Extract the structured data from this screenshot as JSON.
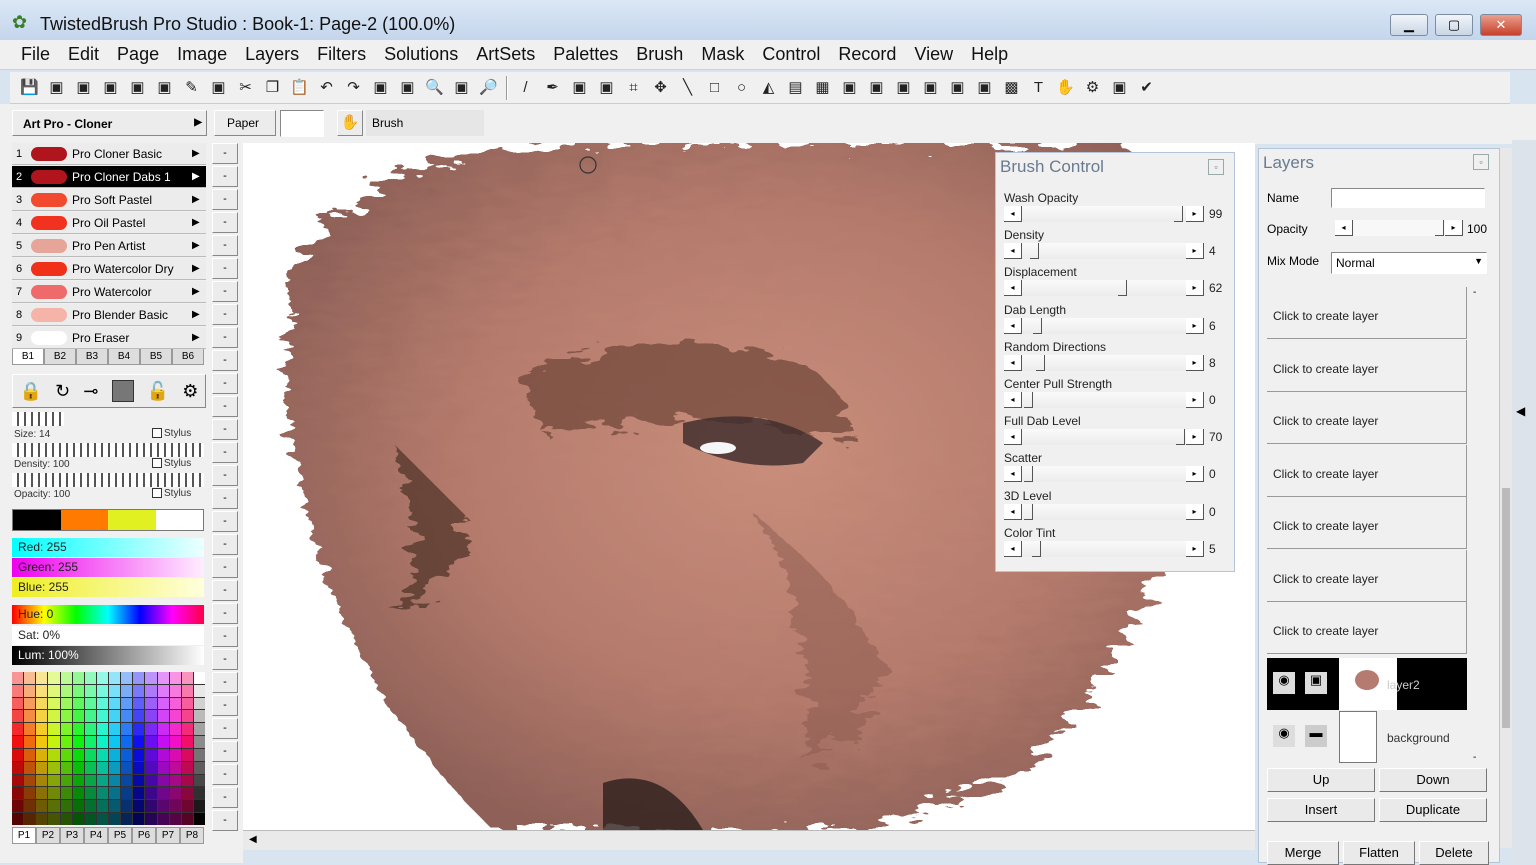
{
  "window": {
    "title": "TwistedBrush Pro Studio : Book-1: Page-2 (100.0%)",
    "minimize": "▁",
    "maximize": "▢",
    "close": "✕"
  },
  "menu": [
    "File",
    "Edit",
    "Page",
    "Image",
    "Layers",
    "Filters",
    "Solutions",
    "ArtSets",
    "Palettes",
    "Brush",
    "Mask",
    "Control",
    "Record",
    "View",
    "Help"
  ],
  "toolbar": {
    "icons": [
      "save-icon",
      "save-as-icon",
      "page-icon",
      "new-page-icon",
      "page-settings-icon",
      "pages-icon",
      "pencil-icon",
      "print-icon",
      "cut-icon",
      "copy-icon",
      "paste-icon",
      "undo-icon",
      "redo-icon",
      "repeat-icon",
      "clear-icon",
      "zoom-in-icon",
      "fit-icon",
      "zoom-out-icon",
      "|",
      "line-brush-icon",
      "eyedropper-icon",
      "select-icon",
      "rect-select-icon",
      "crop-icon",
      "move-icon",
      "line-icon",
      "rect-icon",
      "ellipse-icon",
      "fill-icon",
      "gradient-icon",
      "pattern-icon",
      "shape-icon",
      "tree-icon",
      "lasso-icon",
      "spray-icon",
      "stamp-icon",
      "clone-icon",
      "grid-icon",
      "text-icon",
      "hand-icon",
      "settings-icon",
      "tool-icon",
      "check-icon"
    ]
  },
  "artset": {
    "name": "Art Pro - Cloner"
  },
  "paper_label": "Paper",
  "brush_label": "Brush",
  "brushes": [
    {
      "num": "1",
      "name": "Pro Cloner Basic",
      "color": "#b0141c"
    },
    {
      "num": "2",
      "name": "Pro Cloner Dabs 1",
      "color": "#b0141c"
    },
    {
      "num": "3",
      "name": "Pro Soft Pastel",
      "color": "#f24a2e"
    },
    {
      "num": "4",
      "name": "Pro Oil Pastel",
      "color": "#f0321e"
    },
    {
      "num": "5",
      "name": "Pro Pen Artist",
      "color": "#e7a59a"
    },
    {
      "num": "6",
      "name": "Pro Watercolor Dry",
      "color": "#f03018"
    },
    {
      "num": "7",
      "name": "Pro Watercolor",
      "color": "#ef6a6a"
    },
    {
      "num": "8",
      "name": "Pro Blender Basic",
      "color": "#f6b3a8"
    },
    {
      "num": "9",
      "name": "Pro Eraser",
      "color": "#ffffff"
    }
  ],
  "brush_tabs": [
    "B1",
    "B2",
    "B3",
    "B4",
    "B5",
    "B6"
  ],
  "controls": {
    "size": "Size: 14",
    "density": "Density: 100",
    "opacity": "Opacity: 100",
    "stylus": "Stylus",
    "size_value": 14,
    "density_value": 100,
    "opacity_value": 100
  },
  "swatches": [
    "#000000",
    "#ff7a00",
    "#e0f020",
    "#ffffff"
  ],
  "rgb": {
    "red": "Red: 255",
    "green": "Green: 255",
    "blue": "Blue: 255"
  },
  "hsl": {
    "hue": "Hue: 0",
    "sat": "Sat: 0%",
    "lum": "Lum: 100%"
  },
  "palette_tabs": [
    "P1",
    "P2",
    "P3",
    "P4",
    "P5",
    "P6",
    "P7",
    "P8"
  ],
  "brush_control": {
    "title": "Brush Control",
    "sliders": [
      {
        "label": "Wash Opacity",
        "value": "99",
        "pct": 99
      },
      {
        "label": "Density",
        "value": "4",
        "pct": 4
      },
      {
        "label": "Displacement",
        "value": "62",
        "pct": 62
      },
      {
        "label": "Dab Length",
        "value": "6",
        "pct": 6
      },
      {
        "label": "Random Directions",
        "value": "8",
        "pct": 8
      },
      {
        "label": "Center Pull Strength",
        "value": "0",
        "pct": 0
      },
      {
        "label": "Full Dab Level",
        "value": "70",
        "pct": 100
      },
      {
        "label": "Scatter",
        "value": "0",
        "pct": 0
      },
      {
        "label": "3D Level",
        "value": "0",
        "pct": 0
      },
      {
        "label": "Color Tint",
        "value": "5",
        "pct": 5
      }
    ]
  },
  "layers": {
    "title": "Layers",
    "name_label": "Name",
    "name_value": "",
    "opacity_label": "Opacity",
    "opacity_value": "100",
    "mix_label": "Mix Mode",
    "mix_value": "Normal",
    "empty": [
      "Click to create layer",
      "Click to create layer",
      "Click to create layer",
      "Click to create layer",
      "Click to create layer",
      "Click to create layer",
      "Click to create layer"
    ],
    "layer2": "layer2",
    "background": "background",
    "buttons": {
      "up": "Up",
      "down": "Down",
      "insert": "Insert",
      "duplicate": "Duplicate",
      "merge": "Merge",
      "flatten": "Flatten",
      "delete": "Delete"
    }
  }
}
